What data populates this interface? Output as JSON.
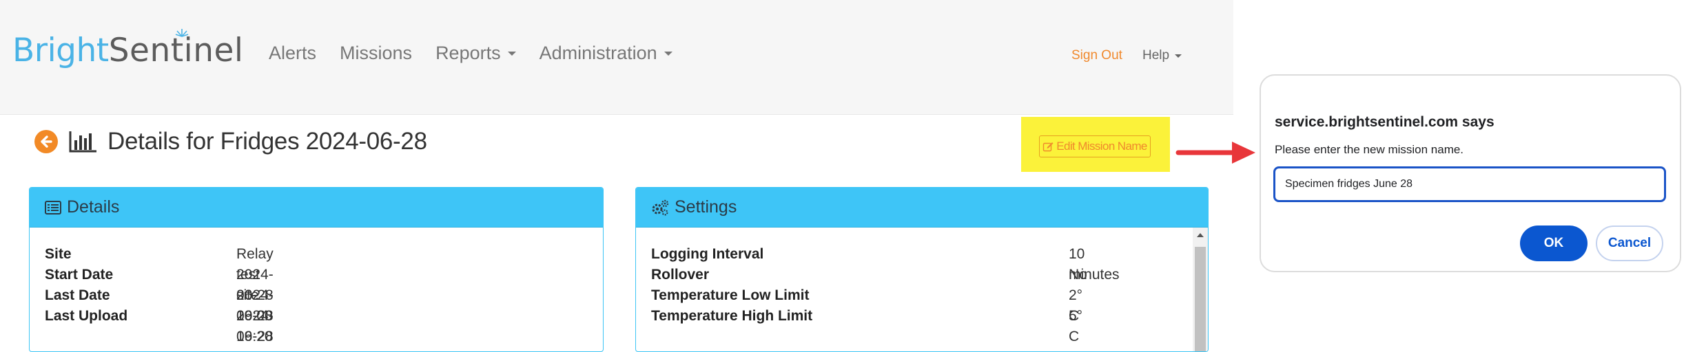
{
  "brand": {
    "bright": "Bright",
    "sentinel": "Sentinel",
    "accent_color": "#4ab3e6"
  },
  "nav": {
    "items": [
      {
        "label": "Alerts",
        "has_dropdown": false
      },
      {
        "label": "Missions",
        "has_dropdown": false
      },
      {
        "label": "Reports",
        "has_dropdown": true
      },
      {
        "label": "Administration",
        "has_dropdown": true
      }
    ],
    "sign_out": "Sign Out",
    "help": "Help"
  },
  "page": {
    "title": "Details for Fridges 2024-06-28",
    "back_icon": "arrow-left-circle-icon",
    "title_icon": "bar-chart-icon",
    "edit_button": "Edit Mission Name",
    "highlight_color": "#fbf23a",
    "annotation_arrow_color": "#e8363a"
  },
  "details_panel": {
    "title": "Details",
    "icon": "list-alt-icon",
    "rows": [
      {
        "label": "Site",
        "value": "Relay test site"
      },
      {
        "label": "Start Date",
        "value": "2024-06-28 19:00"
      },
      {
        "label": "Last Date",
        "value": "2024-06-28 19:20"
      },
      {
        "label": "Last Upload",
        "value": "2024-06-28 19:22"
      }
    ]
  },
  "settings_panel": {
    "title": "Settings",
    "icon": "cogs-icon",
    "rows": [
      {
        "label": "Logging Interval",
        "value": "10 minutes"
      },
      {
        "label": "Rollover",
        "value": "No"
      },
      {
        "label": "Temperature Low Limit",
        "value": "2° C"
      },
      {
        "label": "Temperature High Limit",
        "value": "5° C"
      }
    ]
  },
  "dialog": {
    "title": "service.brightsentinel.com says",
    "message": "Please enter the new mission name.",
    "input_value": "Specimen fridges June 28",
    "ok": "OK",
    "cancel": "Cancel"
  }
}
